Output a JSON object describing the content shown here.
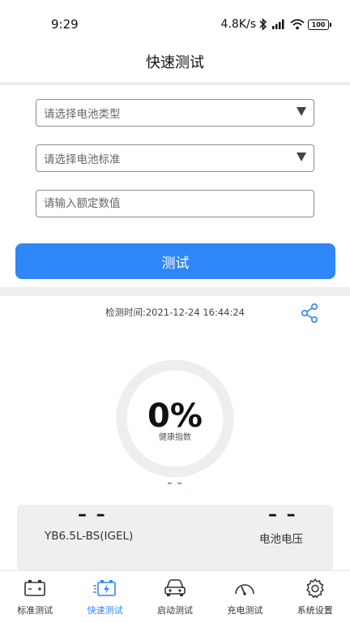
{
  "status_bar": {
    "time": "9:29",
    "net_speed": "4.8K/s",
    "battery": "100"
  },
  "header": {
    "title": "快速测试"
  },
  "form": {
    "battery_type_placeholder": "请选择电池类型",
    "battery_standard_placeholder": "请选择电池标准",
    "rated_value_placeholder": "请输入额定数值",
    "test_button_label": "测试"
  },
  "result": {
    "detect_time": "检测时间:2021-12-24 16:44:24",
    "health_value": "0%",
    "health_label": "健康指数",
    "health_fraction": 0,
    "health_status": "– –",
    "card": {
      "left_value": "– –",
      "left_label": "YB6.5L-BS(IGEL)",
      "right_value": "– –",
      "right_label": "电池电压"
    }
  },
  "tabs": [
    {
      "label": "标准测试",
      "icon": "battery-icon",
      "active": false
    },
    {
      "label": "快速测试",
      "icon": "fast-charge-battery-icon",
      "active": true
    },
    {
      "label": "启动测试",
      "icon": "car-icon",
      "active": false
    },
    {
      "label": "充电测试",
      "icon": "gauge-icon",
      "active": false
    },
    {
      "label": "系统设置",
      "icon": "gear-icon",
      "active": false
    }
  ],
  "colors": {
    "accent": "#2f86f6",
    "status_green": "#3aa35a",
    "gauge_track": "#eeeeee"
  }
}
